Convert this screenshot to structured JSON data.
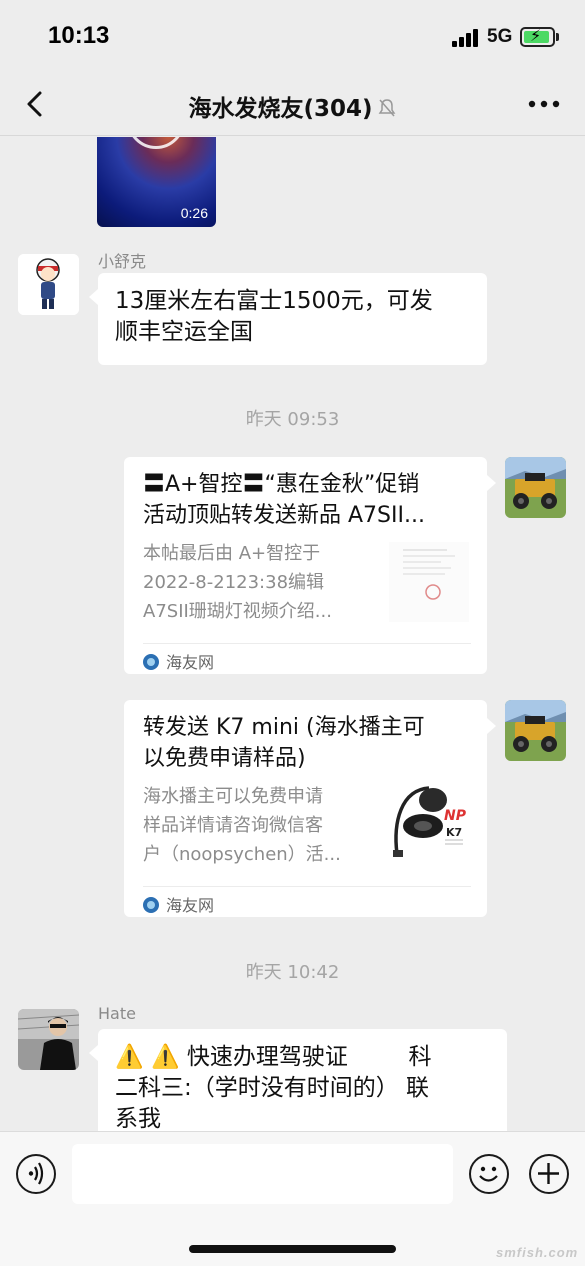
{
  "status_bar": {
    "time": "10:13",
    "network": "5G"
  },
  "header": {
    "title": "海水发烧友(304)"
  },
  "messages": {
    "video": {
      "duration": "0:26"
    },
    "msg1": {
      "sender": "小舒克",
      "lines": [
        "13厘米左右富士1500元，可发",
        "顺丰空运全国"
      ]
    },
    "time1": "昨天 09:53",
    "card1": {
      "title_lines": [
        "〓A+智控〓“惠在金秋”促销",
        "活动顶贴转发送新品 A7SII..."
      ],
      "desc_lines": [
        "本帖最后由 A+智控于",
        "2022-8-2123:38编辑",
        "A7SII珊瑚灯视频介绍..."
      ],
      "source": "海友网"
    },
    "card2": {
      "title_lines": [
        "转发送 K7 mini (海水播主可",
        "以免费申请样品)"
      ],
      "desc_lines": [
        "海水播主可以免费申请",
        "样品详情请咨询微信客",
        "户（noopsychen）活..."
      ],
      "source": "海友网",
      "thumb_brand": "NP",
      "thumb_model": "K7"
    },
    "time2": "昨天 10:42",
    "msg2": {
      "sender": "Hate",
      "lines": [
        "⚠️ ⚠️ 快速办理驾驶证 　　 科",
        "二科三:（学时没有时间的） 联",
        "系我"
      ]
    }
  },
  "watermark": "smfish.com",
  "colors": {
    "background": "#ededed",
    "bubble": "#ffffff",
    "battery": "#4cd964"
  }
}
